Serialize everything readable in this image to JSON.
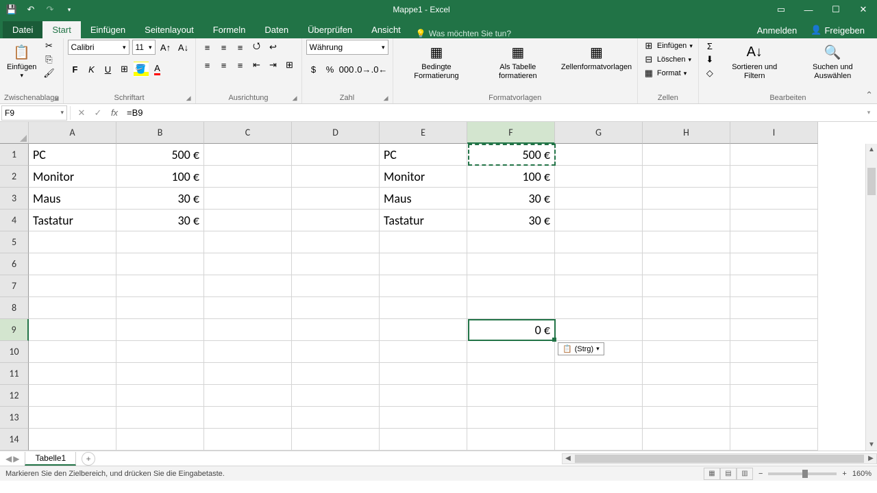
{
  "app": {
    "title": "Mappe1 - Excel"
  },
  "ribbon": {
    "tabs": {
      "file": "Datei",
      "home": "Start",
      "insert": "Einfügen",
      "pagelayout": "Seitenlayout",
      "formulas": "Formeln",
      "data": "Daten",
      "review": "Überprüfen",
      "view": "Ansicht"
    },
    "tellme": "Was möchten Sie tun?",
    "signin": "Anmelden",
    "share": "Freigeben",
    "groups": {
      "clipboard": "Zwischenablage",
      "font": "Schriftart",
      "alignment": "Ausrichtung",
      "number": "Zahl",
      "styles": "Formatvorlagen",
      "cells": "Zellen",
      "editing": "Bearbeiten"
    },
    "paste": "Einfügen",
    "font_name": "Calibri",
    "font_size": "11",
    "bold": "F",
    "italic": "K",
    "underline": "U",
    "number_format": "Währung",
    "cond_format": "Bedingte Formatierung",
    "as_table": "Als Tabelle formatieren",
    "cell_styles": "Zellenformatvorlagen",
    "insert_btn": "Einfügen",
    "delete_btn": "Löschen",
    "format_btn": "Format",
    "sort_filter": "Sortieren und Filtern",
    "find_select": "Suchen und Auswählen"
  },
  "formula_bar": {
    "name_box": "F9",
    "formula": "=B9"
  },
  "columns": [
    "A",
    "B",
    "C",
    "D",
    "E",
    "F",
    "G",
    "H",
    "I"
  ],
  "rows": [
    "1",
    "2",
    "3",
    "4",
    "5",
    "6",
    "7",
    "8",
    "9",
    "10",
    "11",
    "12",
    "13",
    "14"
  ],
  "cells": {
    "A1": "PC",
    "B1": "500 €",
    "E1": "PC",
    "F1": "500 €",
    "A2": "Monitor",
    "B2": "100 €",
    "E2": "Monitor",
    "F2": "100 €",
    "A3": "Maus",
    "B3": "30 €",
    "E3": "Maus",
    "F3": "30 €",
    "A4": "Tastatur",
    "B4": "30 €",
    "E4": "Tastatur",
    "F4": "30 €",
    "F9": "0 €"
  },
  "paste_options": "(Strg)",
  "sheet": {
    "tab": "Tabelle1"
  },
  "status": {
    "message": "Markieren Sie den Zielbereich, und drücken Sie die Eingabetaste.",
    "zoom": "160%"
  }
}
